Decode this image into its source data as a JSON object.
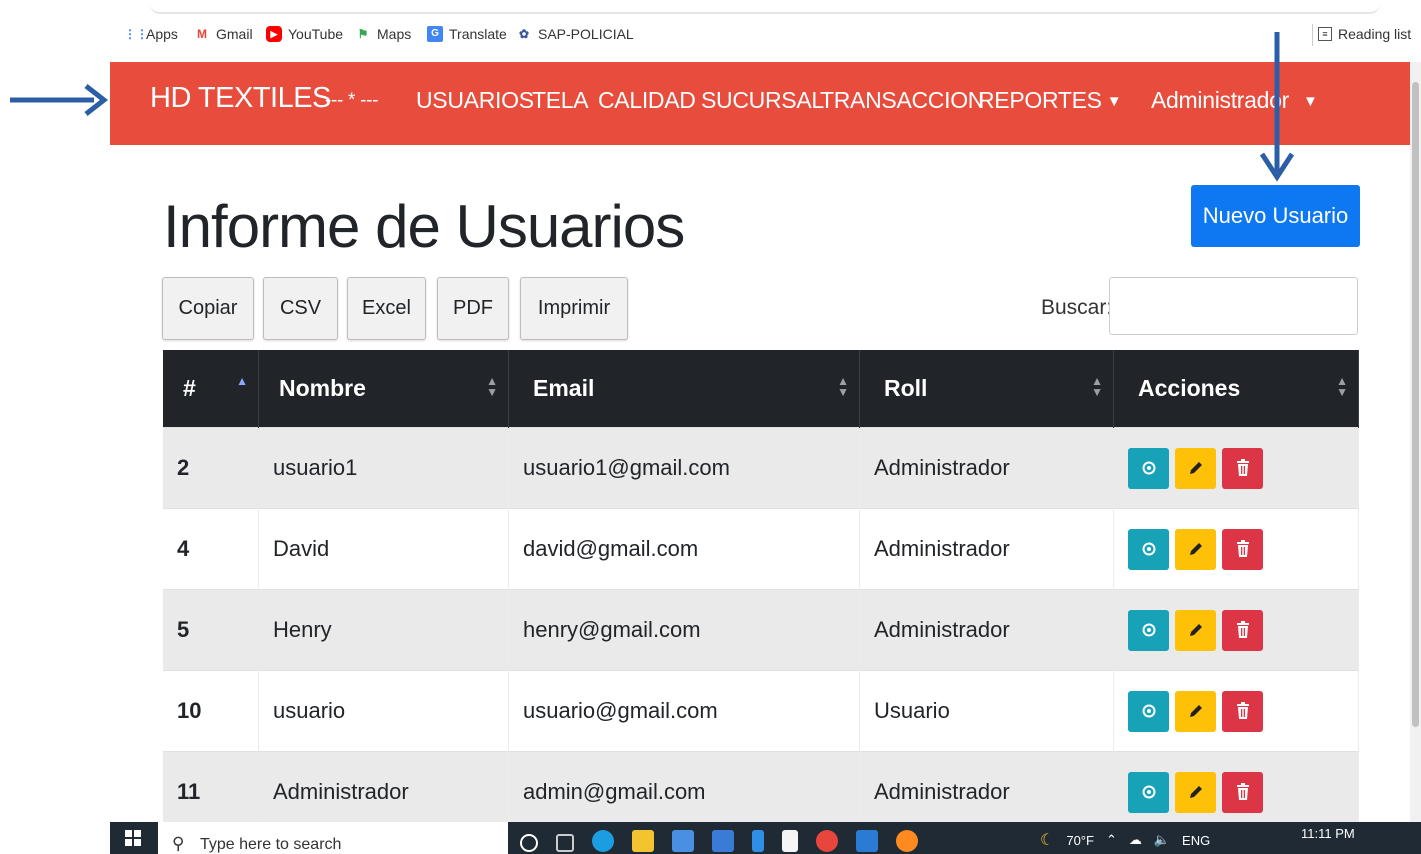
{
  "bookmarks": {
    "items": [
      {
        "label": "Apps",
        "icon": "apps-grid-icon",
        "color": "#4285f4"
      },
      {
        "label": "Gmail",
        "icon": "gmail-icon",
        "color": "#ea4335"
      },
      {
        "label": "YouTube",
        "icon": "youtube-icon",
        "color": "#ff0000"
      },
      {
        "label": "Maps",
        "icon": "maps-icon",
        "color": "#34a853"
      },
      {
        "label": "Translate",
        "icon": "translate-icon",
        "color": "#4285f4"
      },
      {
        "label": "SAP-POLICIAL",
        "icon": "sap-icon",
        "color": "#3b5998"
      }
    ],
    "reading_list": "Reading list"
  },
  "navbar": {
    "brand": "HD TEXTILES",
    "items": [
      "--- * ---",
      "USUARIOS",
      "TELA",
      "CALIDAD",
      "SUCURSAL",
      "TRANSACCION",
      "REPORTES"
    ],
    "user": "Administrador",
    "color": "#e74c3c"
  },
  "page": {
    "title": "Informe de Usuarios",
    "new_button": "Nuevo Usuario",
    "tools": [
      "Copiar",
      "CSV",
      "Excel",
      "PDF",
      "Imprimir"
    ],
    "search_label": "Buscar:",
    "search_value": ""
  },
  "table": {
    "headers": [
      "#",
      "Nombre",
      "Email",
      "Roll",
      "Acciones"
    ],
    "rows": [
      {
        "id": "2",
        "name": "usuario1",
        "email": "usuario1@gmail.com",
        "role": "Administrador"
      },
      {
        "id": "4",
        "name": "David",
        "email": "david@gmail.com",
        "role": "Administrador"
      },
      {
        "id": "5",
        "name": "Henry",
        "email": "henry@gmail.com",
        "role": "Administrador"
      },
      {
        "id": "10",
        "name": "usuario",
        "email": "usuario@gmail.com",
        "role": "Usuario"
      },
      {
        "id": "11",
        "name": "Administrador",
        "email": "admin@gmail.com",
        "role": "Administrador"
      }
    ],
    "action_colors": {
      "view": "#17a2b8",
      "edit": "#ffc107",
      "delete": "#dc3545"
    }
  },
  "taskbar": {
    "search_placeholder": "Type here to search",
    "weather": "70°F",
    "lang": "ENG",
    "time": "11:11 PM"
  }
}
